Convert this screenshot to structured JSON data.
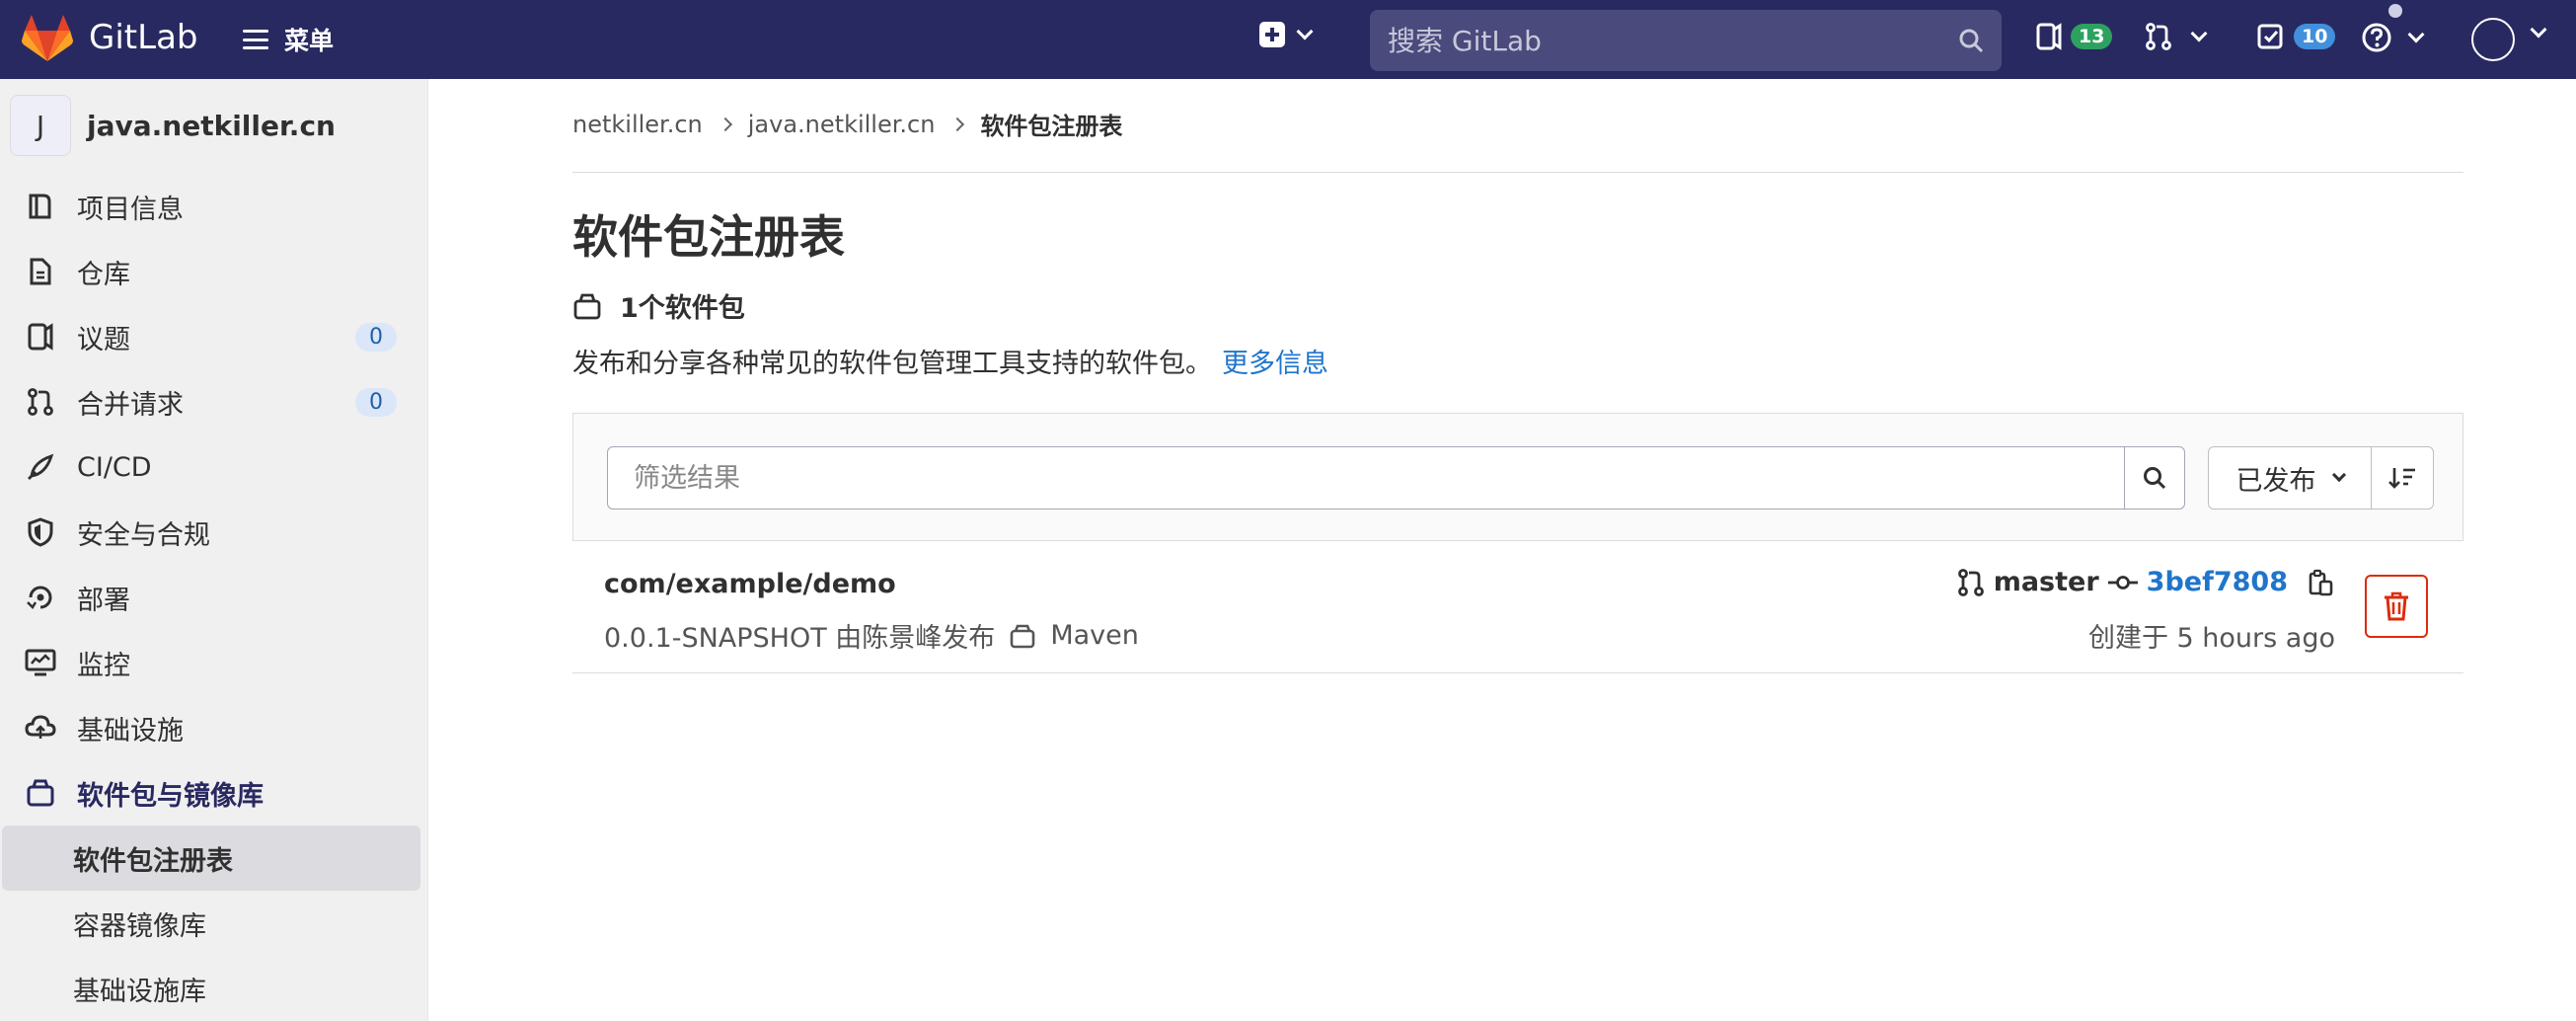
{
  "topbar": {
    "brand": "GitLab",
    "menu_label": "菜单",
    "search_placeholder": "搜索 GitLab",
    "issues_count": "13",
    "todos_count": "10"
  },
  "sidebar": {
    "project_initial": "J",
    "project_name": "java.netkiller.cn",
    "items": [
      {
        "label": "项目信息"
      },
      {
        "label": "仓库"
      },
      {
        "label": "议题",
        "count": "0"
      },
      {
        "label": "合并请求",
        "count": "0"
      },
      {
        "label": "CI/CD"
      },
      {
        "label": "安全与合规"
      },
      {
        "label": "部署"
      },
      {
        "label": "监控"
      },
      {
        "label": "基础设施"
      },
      {
        "label": "软件包与镜像库"
      }
    ],
    "sub_items": [
      {
        "label": "软件包注册表"
      },
      {
        "label": "容器镜像库"
      },
      {
        "label": "基础设施库"
      }
    ]
  },
  "breadcrumb": [
    "netkiller.cn",
    "java.netkiller.cn",
    "软件包注册表"
  ],
  "page": {
    "title": "软件包注册表",
    "count_text": "1个软件包",
    "description": "发布和分享各种常见的软件包管理工具支持的软件包。",
    "more_link": "更多信息"
  },
  "filter": {
    "placeholder": "筛选结果",
    "sort_label": "已发布"
  },
  "packages": [
    {
      "name": "com/example/demo",
      "version_text": "0.0.1-SNAPSHOT 由陈景峰发布",
      "type": "Maven",
      "branch": "master",
      "commit": "3bef7808",
      "created": "创建于 5 hours ago"
    }
  ],
  "colors": {
    "topbar": "#292961",
    "link": "#1f75cb",
    "danger": "#dd2b0e",
    "badge_green": "#2da160",
    "badge_blue": "#428fdc"
  }
}
